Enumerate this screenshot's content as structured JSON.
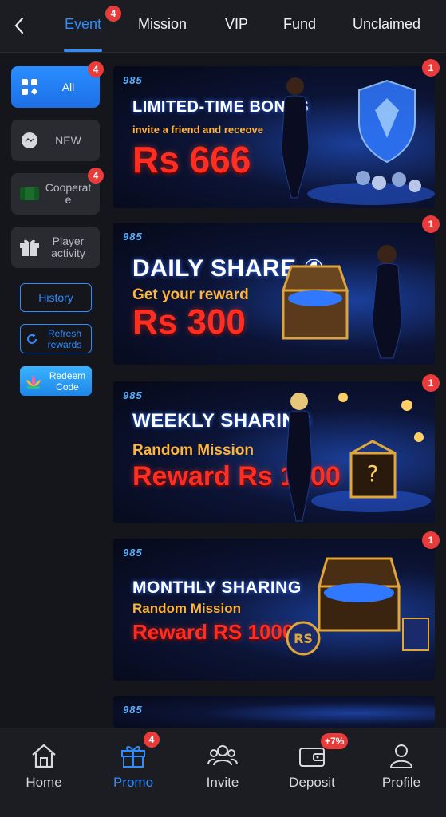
{
  "tabs": {
    "items": [
      {
        "label": "Event",
        "badge": "4"
      },
      {
        "label": "Mission"
      },
      {
        "label": "VIP"
      },
      {
        "label": "Fund"
      },
      {
        "label": "Unclaimed"
      }
    ],
    "active": "Event"
  },
  "sidebar": {
    "items": [
      {
        "label": "All",
        "icon": "grid-icon",
        "badge": "4"
      },
      {
        "label": "NEW",
        "icon": "messenger-icon"
      },
      {
        "label": "Cooperat e",
        "icon": "flag-icon",
        "badge": "4"
      },
      {
        "label": "Player activity",
        "icon": "gift-icon"
      }
    ],
    "history_label": "History",
    "refresh_label": "Refresh rewards",
    "redeem_label": "Redeem Code"
  },
  "banners": [
    {
      "logo": "985",
      "title": "LIMITED-TIME BONUS",
      "subtitle": "invite a friend and receove",
      "amount": "Rs 666",
      "badge": "1"
    },
    {
      "logo": "985",
      "title": "DAILY SHARE ④",
      "subtitle": "Get your reward",
      "amount": "Rs 300",
      "badge": "1"
    },
    {
      "logo": "985",
      "title": "WEEKLY SHARING",
      "subtitle": "Random Mission",
      "amount": "Reward Rs 1000",
      "badge": "1"
    },
    {
      "logo": "985",
      "title": "MONTHLY SHARING",
      "subtitle": "Random Mission",
      "amount": "Reward RS 10000",
      "badge": "1"
    },
    {
      "logo": "985"
    }
  ],
  "bottom_nav": {
    "items": [
      {
        "label": "Home",
        "icon": "home-icon"
      },
      {
        "label": "Promo",
        "icon": "gift-icon",
        "badge": "4"
      },
      {
        "label": "Invite",
        "icon": "people-icon"
      },
      {
        "label": "Deposit",
        "icon": "wallet-icon",
        "badge": "+7%"
      },
      {
        "label": "Profile",
        "icon": "person-icon"
      }
    ],
    "active": "Promo"
  },
  "colors": {
    "accent": "#2f8cff",
    "badge": "#ea3b3b",
    "background": "#15161b",
    "amount_red": "#ff2e22",
    "subtitle_orange": "#ffb43a"
  }
}
